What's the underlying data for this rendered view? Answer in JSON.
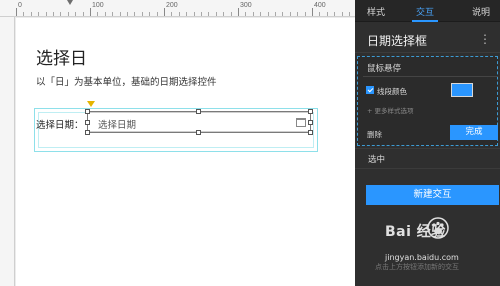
{
  "ruler": {
    "labels": [
      "0",
      "100",
      "200",
      "300",
      "400"
    ]
  },
  "canvas": {
    "heading": "选择日",
    "description": "以「日」为基本单位，基础的日期选择控件",
    "date_label": "选择日期：",
    "date_placeholder": "选择日期"
  },
  "panel": {
    "tabs": [
      "样式",
      "交互",
      "说明"
    ],
    "active_tab": "交互",
    "title": "日期选择框",
    "kebab": "⋮",
    "hover_section": {
      "title": "鼠标悬停",
      "checkbox_label": "线段颜色",
      "checkbox_checked": true,
      "color_value": "#2a96ff",
      "more_styles": "+ 更多样式选项",
      "delete_label": "删除",
      "done_label": "完成"
    },
    "selected_label": "选中",
    "new_interaction_label": "新建交互",
    "hint": "点击上方按钮添加新的交互"
  },
  "watermark": {
    "brand": "Bai 经验",
    "url": "jingyan.baidu.com"
  },
  "colors": {
    "accent": "#2a96ff",
    "panel_bg": "#2f2f2f",
    "selection": "#8ee0ea",
    "anchor": "#e5b400"
  }
}
